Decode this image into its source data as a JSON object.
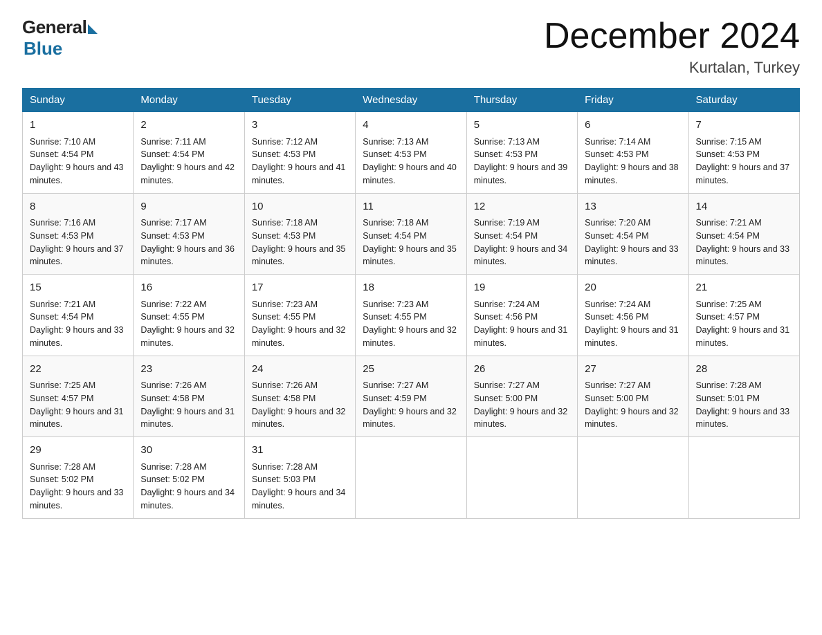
{
  "header": {
    "logo_general": "General",
    "logo_blue": "Blue",
    "month_title": "December 2024",
    "location": "Kurtalan, Turkey"
  },
  "days_of_week": [
    "Sunday",
    "Monday",
    "Tuesday",
    "Wednesday",
    "Thursday",
    "Friday",
    "Saturday"
  ],
  "weeks": [
    [
      {
        "day": "1",
        "sunrise": "7:10 AM",
        "sunset": "4:54 PM",
        "daylight": "9 hours and 43 minutes."
      },
      {
        "day": "2",
        "sunrise": "7:11 AM",
        "sunset": "4:54 PM",
        "daylight": "9 hours and 42 minutes."
      },
      {
        "day": "3",
        "sunrise": "7:12 AM",
        "sunset": "4:53 PM",
        "daylight": "9 hours and 41 minutes."
      },
      {
        "day": "4",
        "sunrise": "7:13 AM",
        "sunset": "4:53 PM",
        "daylight": "9 hours and 40 minutes."
      },
      {
        "day": "5",
        "sunrise": "7:13 AM",
        "sunset": "4:53 PM",
        "daylight": "9 hours and 39 minutes."
      },
      {
        "day": "6",
        "sunrise": "7:14 AM",
        "sunset": "4:53 PM",
        "daylight": "9 hours and 38 minutes."
      },
      {
        "day": "7",
        "sunrise": "7:15 AM",
        "sunset": "4:53 PM",
        "daylight": "9 hours and 37 minutes."
      }
    ],
    [
      {
        "day": "8",
        "sunrise": "7:16 AM",
        "sunset": "4:53 PM",
        "daylight": "9 hours and 37 minutes."
      },
      {
        "day": "9",
        "sunrise": "7:17 AM",
        "sunset": "4:53 PM",
        "daylight": "9 hours and 36 minutes."
      },
      {
        "day": "10",
        "sunrise": "7:18 AM",
        "sunset": "4:53 PM",
        "daylight": "9 hours and 35 minutes."
      },
      {
        "day": "11",
        "sunrise": "7:18 AM",
        "sunset": "4:54 PM",
        "daylight": "9 hours and 35 minutes."
      },
      {
        "day": "12",
        "sunrise": "7:19 AM",
        "sunset": "4:54 PM",
        "daylight": "9 hours and 34 minutes."
      },
      {
        "day": "13",
        "sunrise": "7:20 AM",
        "sunset": "4:54 PM",
        "daylight": "9 hours and 33 minutes."
      },
      {
        "day": "14",
        "sunrise": "7:21 AM",
        "sunset": "4:54 PM",
        "daylight": "9 hours and 33 minutes."
      }
    ],
    [
      {
        "day": "15",
        "sunrise": "7:21 AM",
        "sunset": "4:54 PM",
        "daylight": "9 hours and 33 minutes."
      },
      {
        "day": "16",
        "sunrise": "7:22 AM",
        "sunset": "4:55 PM",
        "daylight": "9 hours and 32 minutes."
      },
      {
        "day": "17",
        "sunrise": "7:23 AM",
        "sunset": "4:55 PM",
        "daylight": "9 hours and 32 minutes."
      },
      {
        "day": "18",
        "sunrise": "7:23 AM",
        "sunset": "4:55 PM",
        "daylight": "9 hours and 32 minutes."
      },
      {
        "day": "19",
        "sunrise": "7:24 AM",
        "sunset": "4:56 PM",
        "daylight": "9 hours and 31 minutes."
      },
      {
        "day": "20",
        "sunrise": "7:24 AM",
        "sunset": "4:56 PM",
        "daylight": "9 hours and 31 minutes."
      },
      {
        "day": "21",
        "sunrise": "7:25 AM",
        "sunset": "4:57 PM",
        "daylight": "9 hours and 31 minutes."
      }
    ],
    [
      {
        "day": "22",
        "sunrise": "7:25 AM",
        "sunset": "4:57 PM",
        "daylight": "9 hours and 31 minutes."
      },
      {
        "day": "23",
        "sunrise": "7:26 AM",
        "sunset": "4:58 PM",
        "daylight": "9 hours and 31 minutes."
      },
      {
        "day": "24",
        "sunrise": "7:26 AM",
        "sunset": "4:58 PM",
        "daylight": "9 hours and 32 minutes."
      },
      {
        "day": "25",
        "sunrise": "7:27 AM",
        "sunset": "4:59 PM",
        "daylight": "9 hours and 32 minutes."
      },
      {
        "day": "26",
        "sunrise": "7:27 AM",
        "sunset": "5:00 PM",
        "daylight": "9 hours and 32 minutes."
      },
      {
        "day": "27",
        "sunrise": "7:27 AM",
        "sunset": "5:00 PM",
        "daylight": "9 hours and 32 minutes."
      },
      {
        "day": "28",
        "sunrise": "7:28 AM",
        "sunset": "5:01 PM",
        "daylight": "9 hours and 33 minutes."
      }
    ],
    [
      {
        "day": "29",
        "sunrise": "7:28 AM",
        "sunset": "5:02 PM",
        "daylight": "9 hours and 33 minutes."
      },
      {
        "day": "30",
        "sunrise": "7:28 AM",
        "sunset": "5:02 PM",
        "daylight": "9 hours and 34 minutes."
      },
      {
        "day": "31",
        "sunrise": "7:28 AM",
        "sunset": "5:03 PM",
        "daylight": "9 hours and 34 minutes."
      },
      null,
      null,
      null,
      null
    ]
  ]
}
